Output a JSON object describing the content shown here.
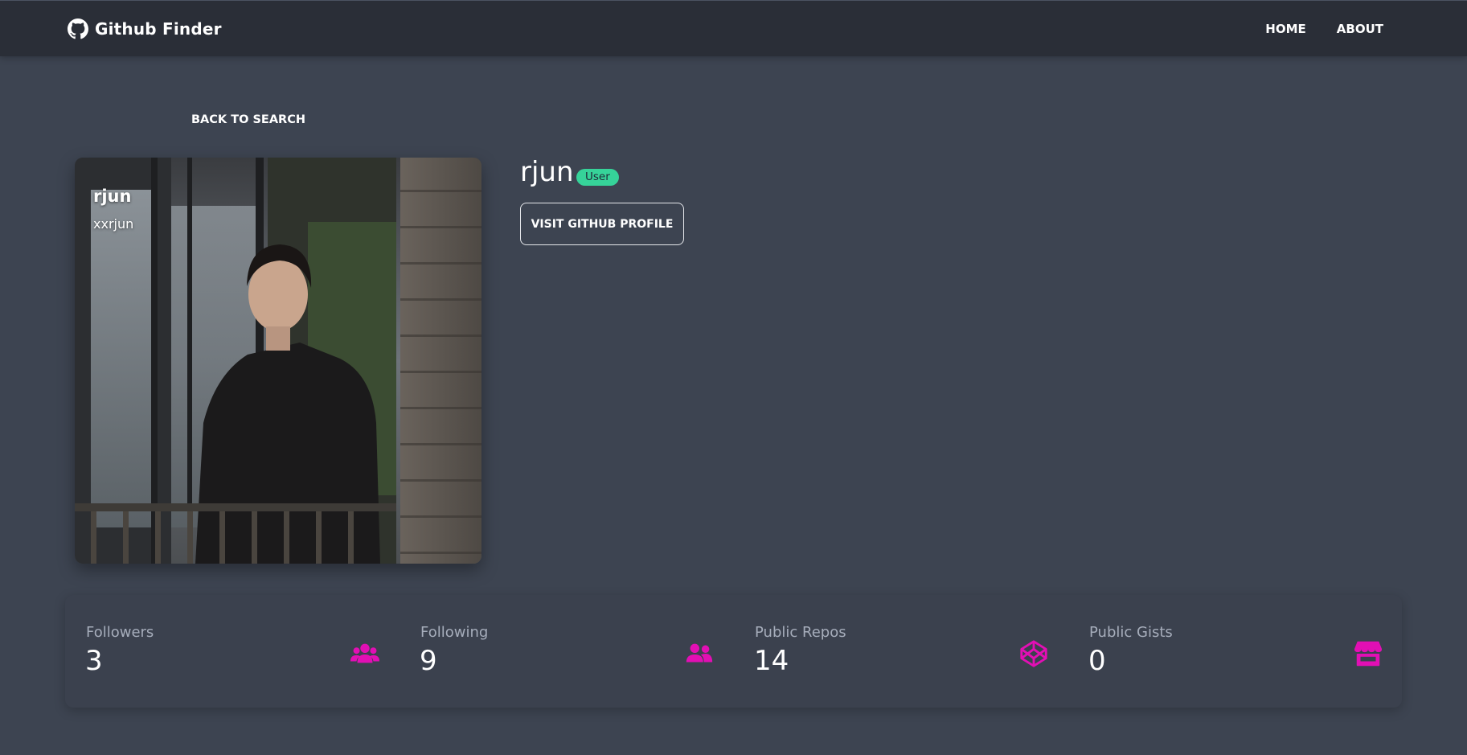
{
  "navbar": {
    "brand": "Github Finder",
    "brand_icon": "github-icon",
    "links": [
      "HOME",
      "ABOUT"
    ]
  },
  "back_link": "BACK TO SEARCH",
  "profile": {
    "name": "rjun",
    "login": "xxrjun",
    "type_badge": "User",
    "visit_button": "VISIT GITHUB PROFILE"
  },
  "stats": [
    {
      "title": "Followers",
      "value": "3",
      "icon": "users-icon"
    },
    {
      "title": "Following",
      "value": "9",
      "icon": "user-friends-icon"
    },
    {
      "title": "Public Repos",
      "value": "14",
      "icon": "codepen-icon"
    },
    {
      "title": "Public Gists",
      "value": "0",
      "icon": "store-icon"
    }
  ],
  "colors": {
    "background": "#3d4451",
    "navbar": "#2a2e37",
    "accent_icon": "#e20fb4",
    "badge": "#36d399",
    "stat_title": "#a6adbb"
  }
}
